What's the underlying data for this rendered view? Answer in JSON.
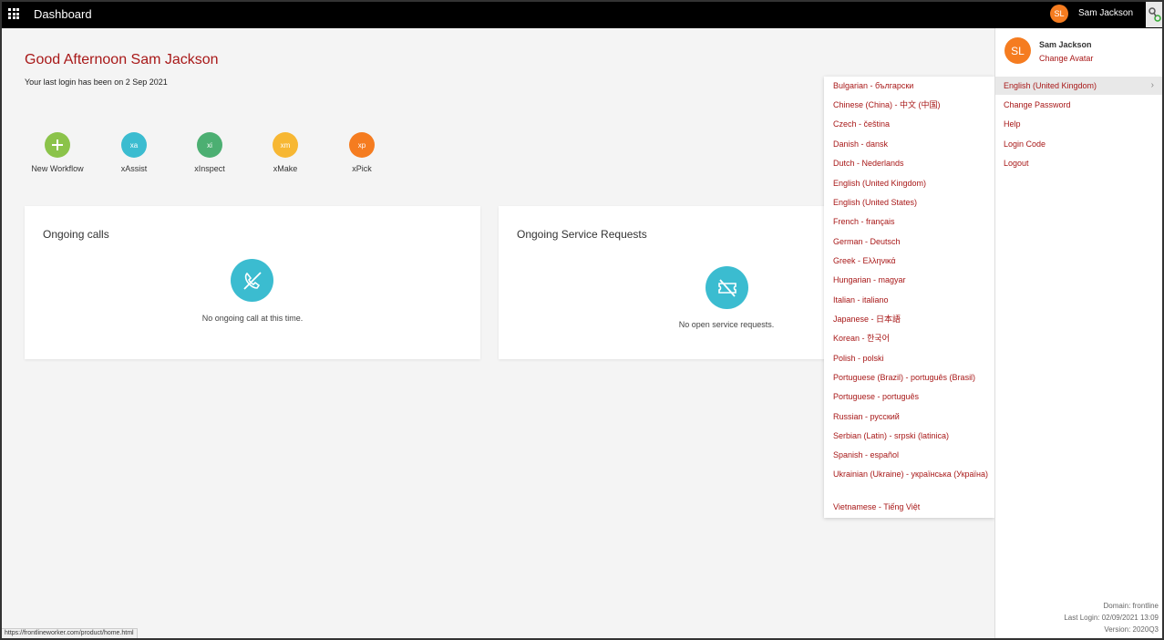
{
  "topbar": {
    "title": "Dashboard",
    "avatar_initials": "SL",
    "user_name": "Sam Jackson"
  },
  "main": {
    "greeting": "Good Afternoon Sam Jackson",
    "last_login": "Your last login has been on 2 Sep 2021"
  },
  "apps": [
    {
      "label": "New Workflow",
      "icon": "plus-icon",
      "badge": "",
      "color": "#8bc34a"
    },
    {
      "label": "xAssist",
      "icon": "xassist-icon",
      "badge": "xa",
      "color": "#3bbcd0"
    },
    {
      "label": "xInspect",
      "icon": "xinspect-icon",
      "badge": "xi",
      "color": "#4caf72"
    },
    {
      "label": "xMake",
      "icon": "xmake-icon",
      "badge": "xm",
      "color": "#f7b733"
    },
    {
      "label": "xPick",
      "icon": "xpick-icon",
      "badge": "xp",
      "color": "#f57c20"
    }
  ],
  "cards": {
    "calls": {
      "title": "Ongoing calls",
      "empty": "No ongoing call at this time."
    },
    "requests": {
      "title": "Ongoing Service Requests",
      "empty": "No open service requests."
    }
  },
  "languages": [
    "Bulgarian - български",
    "Chinese (China) - 中文 (中国)",
    "Czech - čeština",
    "Danish - dansk",
    "Dutch - Nederlands",
    "English (United Kingdom)",
    "English (United States)",
    "French - français",
    "German - Deutsch",
    "Greek - Ελληνικά",
    "Hungarian - magyar",
    "Italian - italiano",
    "Japanese - 日本語",
    "Korean - 한국어",
    "Polish - polski",
    "Portuguese (Brazil) - português (Brasil)",
    "Portuguese - português",
    "Russian - русский",
    "Serbian (Latin) - srpski (latinica)",
    "Spanish - español",
    "Ukrainian (Ukraine) - українська (Україна)",
    "Vietnamese - Tiếng Việt"
  ],
  "panel": {
    "avatar_initials": "SL",
    "name": "Sam Jackson",
    "change_avatar": "Change Avatar",
    "language": "English (United Kingdom)",
    "menu": [
      "Change Password",
      "Help",
      "Login Code",
      "Logout"
    ],
    "footer": {
      "domain": "Domain: frontline",
      "last_login": "Last Login: 02/09/2021 13:09",
      "version": "Version: 2020Q3"
    }
  },
  "statusbar": {
    "url": "https://frontlineworker.com/product/home.html"
  },
  "colors": {
    "accent": "#a81818",
    "avatar": "#f57c20",
    "teal": "#3bbcd0"
  }
}
